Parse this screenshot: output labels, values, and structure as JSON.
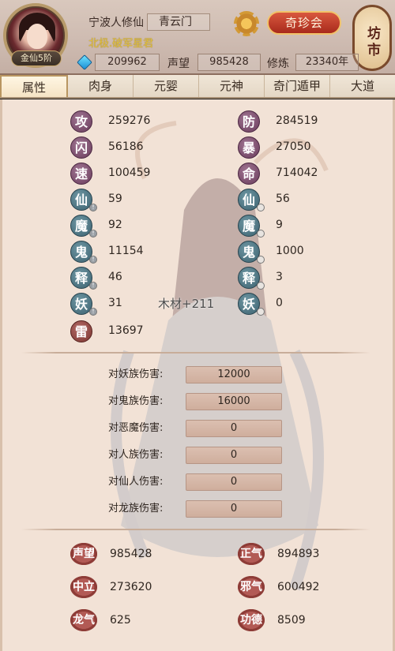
{
  "header": {
    "rank_badge": "金仙5阶",
    "player_name": "宁波人修仙",
    "sect": "青云门",
    "star_title": "北极.破军星君",
    "treasure_button": "奇珍会",
    "market_button": "坊市",
    "spirit_stones": "209962",
    "reputation_label": "声望",
    "reputation_value": "985428",
    "cultivation_label": "修炼",
    "cultivation_value": "23340年",
    "icons": [
      "gear-icon",
      "gem-icon"
    ]
  },
  "tabs": [
    {
      "label": "属性",
      "active": true
    },
    {
      "label": "肉身",
      "active": false
    },
    {
      "label": "元婴",
      "active": false
    },
    {
      "label": "元神",
      "active": false
    },
    {
      "label": "奇门遁甲",
      "active": false
    },
    {
      "label": "大道",
      "active": false
    }
  ],
  "attributes": {
    "left": [
      {
        "badge": "攻",
        "value": "259276"
      },
      {
        "badge": "闪",
        "value": "56186"
      },
      {
        "badge": "速",
        "value": "100459"
      },
      {
        "badge": "仙",
        "value": "59"
      },
      {
        "badge": "魔",
        "value": "92"
      },
      {
        "badge": "鬼",
        "value": "11154"
      },
      {
        "badge": "释",
        "value": "46"
      },
      {
        "badge": "妖",
        "value": "31"
      },
      {
        "badge": "雷",
        "value": "13697"
      }
    ],
    "right": [
      {
        "badge": "防",
        "value": "284519"
      },
      {
        "badge": "暴",
        "value": "27050"
      },
      {
        "badge": "命",
        "value": "714042"
      },
      {
        "badge": "仙",
        "value": "56"
      },
      {
        "badge": "魔",
        "value": "9"
      },
      {
        "badge": "鬼",
        "value": "1000"
      },
      {
        "badge": "释",
        "value": "3"
      },
      {
        "badge": "妖",
        "value": "0"
      }
    ]
  },
  "floating_text": "木材+211",
  "damage_bonuses": [
    {
      "label": "对妖族伤害:",
      "value": "12000"
    },
    {
      "label": "对鬼族伤害:",
      "value": "16000"
    },
    {
      "label": "对恶魔伤害:",
      "value": "0"
    },
    {
      "label": "对人族伤害:",
      "value": "0"
    },
    {
      "label": "对仙人伤害:",
      "value": "0"
    },
    {
      "label": "对龙族伤害:",
      "value": "0"
    }
  ],
  "moral_stats": [
    {
      "badge": "声望",
      "value": "985428"
    },
    {
      "badge": "正气",
      "value": "894893"
    },
    {
      "badge": "中立",
      "value": "273620"
    },
    {
      "badge": "邪气",
      "value": "600492"
    },
    {
      "badge": "龙气",
      "value": "625"
    },
    {
      "badge": "功德",
      "value": "8509"
    }
  ],
  "colors": {
    "panel_bg": "#f2e2d6",
    "badge_purple": "#6a3c5c",
    "badge_teal": "#3c6270",
    "badge_red": "#7c3530",
    "treasure_red": "#a82a1c",
    "star_gold": "#e3c23c"
  }
}
